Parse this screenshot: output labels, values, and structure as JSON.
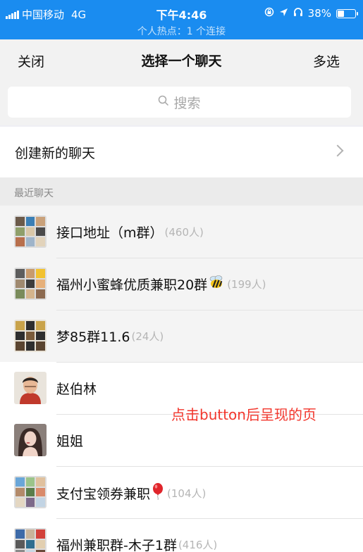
{
  "status_bar": {
    "carrier": "中国移动",
    "network": "4G",
    "time": "下午4:46",
    "hotspot": "个人热点：1 个连接",
    "battery": "38%",
    "battery_level": 0.38
  },
  "navbar": {
    "close_label": "关闭",
    "title": "选择一个聊天",
    "multi_select_label": "多选"
  },
  "search": {
    "placeholder": "搜索"
  },
  "new_chat": {
    "label": "创建新的聊天"
  },
  "recent": {
    "section_title": "最近聊天",
    "chats": [
      {
        "name": "接口地址（m群）",
        "count": "(460人)",
        "emoji": ""
      },
      {
        "name": "福州小蜜蜂优质兼职20群",
        "count": "(199人)",
        "emoji": "bee"
      },
      {
        "name": "梦85群11.6",
        "count": "(24人)",
        "emoji": ""
      },
      {
        "name": "赵伯林",
        "count": "",
        "emoji": ""
      },
      {
        "name": "姐姐",
        "count": "",
        "emoji": ""
      },
      {
        "name": "支付宝领券兼职",
        "count": "(104人)",
        "emoji": "balloon"
      },
      {
        "name": "福州兼职群-木子1群",
        "count": "(416人)",
        "emoji": ""
      }
    ]
  },
  "annotation": "点击button后呈现的页",
  "colors": {
    "status_bar_bg": "#1a8cf0",
    "annotation": "#f2362c"
  }
}
